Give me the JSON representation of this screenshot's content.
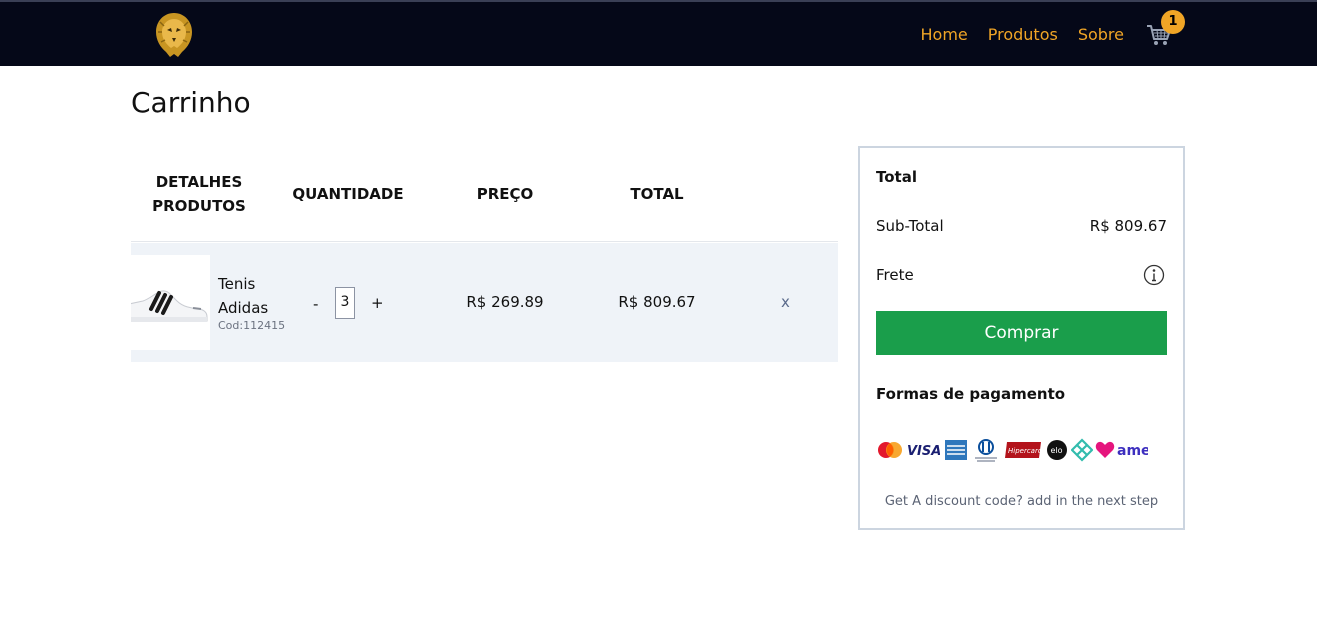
{
  "nav": {
    "links": [
      "Home",
      "Produtos",
      "Sobre"
    ],
    "cart_count": "1",
    "accent": "#f0a526",
    "background": "#050818"
  },
  "page": {
    "title": "Carrinho"
  },
  "table": {
    "headers": {
      "details_line1": "DETALHES",
      "details_line2": "PRODUTOS",
      "quantity": "QUANTIDADE",
      "price": "PREÇO",
      "total": "TOTAL"
    },
    "rows": [
      {
        "name": "Tenis Adidas",
        "code": "Cod:112415",
        "quantity": "3",
        "minus": "-",
        "plus": "+",
        "price": "R$ 269.89",
        "total": "R$ 809.67",
        "remove": "x"
      }
    ]
  },
  "summary": {
    "title": "Total",
    "subtotal_label": "Sub-Total",
    "subtotal_value": "R$ 809.67",
    "shipping_label": "Frete",
    "buy_label": "Comprar",
    "buy_color": "#1a9e4b",
    "payment_title": "Formas de pagamento",
    "payment_methods": [
      "mastercard-icon",
      "visa-icon",
      "amex-icon",
      "diners-icon",
      "hipercard-icon",
      "elo-icon",
      "pix-icon",
      "ame-icon"
    ],
    "payment_labels": {
      "visa": "VISA",
      "hipercard": "Hipercard",
      "elo": "elo",
      "ame": "ame"
    },
    "discount_text": "Get A discount code? add in the next step"
  }
}
